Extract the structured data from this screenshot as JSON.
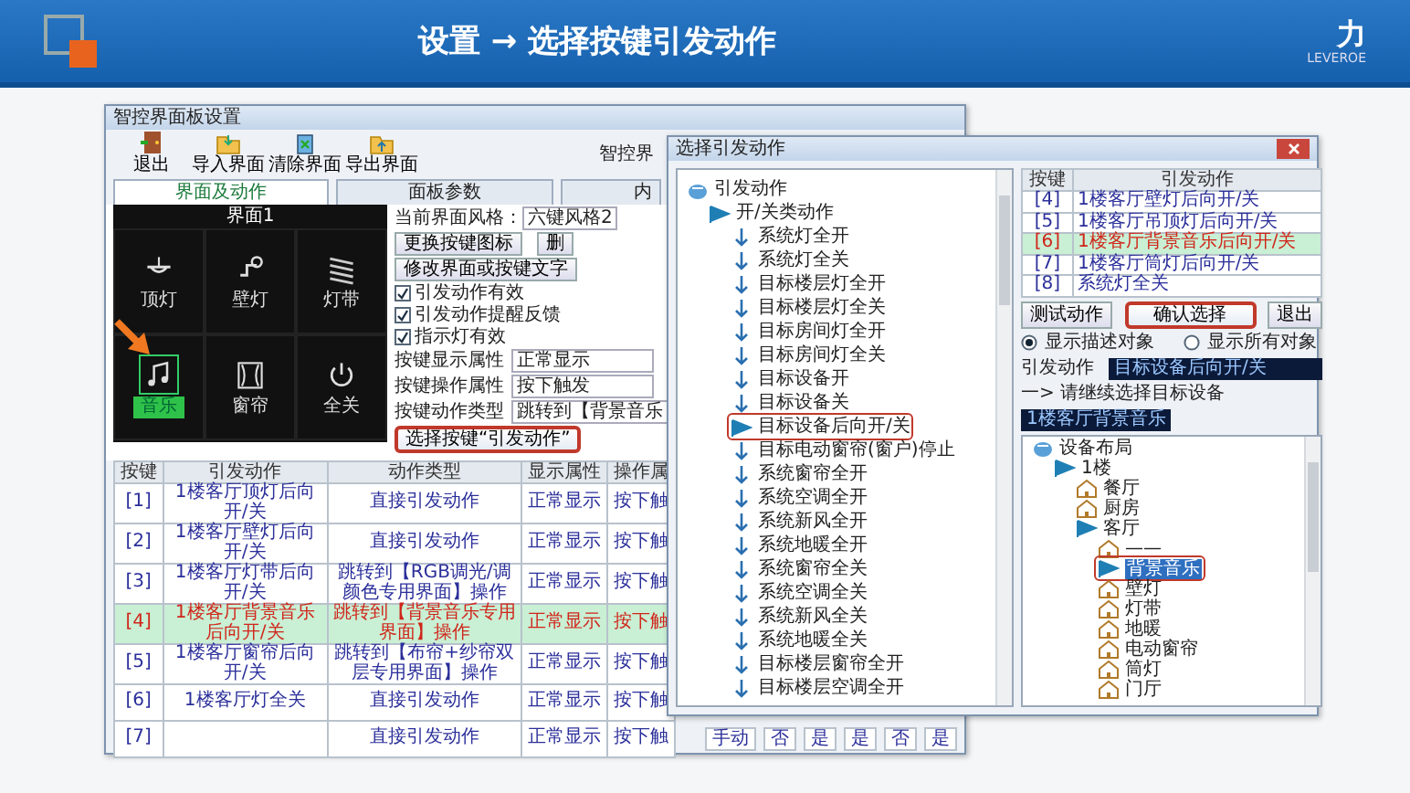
{
  "header": {
    "title": "设置 → 选择按键引发动作",
    "brand": "力",
    "brand_sub": "LEVEROE"
  },
  "main_window": {
    "title": "智控界面板设置",
    "toolbar": [
      {
        "label": "退出",
        "kind": "exit"
      },
      {
        "label": "导入界面",
        "kind": "import"
      },
      {
        "label": "清除界面",
        "kind": "clear"
      },
      {
        "label": "导出界面",
        "kind": "export"
      }
    ],
    "toolbar_caption": "智控界",
    "tabs": [
      {
        "label": "界面及动作",
        "selected": true
      },
      {
        "label": "面板参数",
        "selected": false
      },
      {
        "label": "内",
        "selected": false
      }
    ],
    "panel": {
      "title": "界面1",
      "keys": [
        {
          "label": "顶灯",
          "kind": "ceiling",
          "selected": false
        },
        {
          "label": "壁灯",
          "kind": "wall",
          "selected": false
        },
        {
          "label": "灯带",
          "kind": "strip",
          "selected": false
        },
        {
          "label": "音乐",
          "kind": "music",
          "selected": true
        },
        {
          "label": "窗帘",
          "kind": "curtain",
          "selected": false
        },
        {
          "label": "全关",
          "kind": "power",
          "selected": false
        }
      ]
    },
    "style_label": "当前界面风格：",
    "style_value": "六键风格2",
    "buttons": [
      {
        "label": "更换按键图标"
      },
      {
        "label": "删"
      },
      {
        "label": "修改界面或按键文字"
      }
    ],
    "options": [
      {
        "label": "引发动作有效",
        "checked": true
      },
      {
        "label": "引发动作提醒反馈",
        "checked": true
      },
      {
        "label": "指示灯有效",
        "checked": true
      }
    ],
    "properties": [
      {
        "label": "按键显示属性",
        "value": "正常显示"
      },
      {
        "label": "按键操作属性",
        "value": "按下触发"
      },
      {
        "label": "按键动作类型",
        "value": "跳转到【背景音乐"
      }
    ],
    "select_button": {
      "label": "选择按键“引发动作”",
      "highlighted": true
    },
    "table": {
      "columns": [
        "按键",
        "引发动作",
        "动作类型",
        "显示属性",
        "操作属"
      ],
      "rows": [
        {
          "key": "[1]",
          "action": "1楼客厅顶灯后向开/关",
          "type": "直接引发动作",
          "display": "正常显示",
          "operate": "按下触",
          "selected": false
        },
        {
          "key": "[2]",
          "action": "1楼客厅壁灯后向开/关",
          "type": "直接引发动作",
          "display": "正常显示",
          "operate": "按下触",
          "selected": false
        },
        {
          "key": "[3]",
          "action": "1楼客厅灯带后向开/关",
          "type": "跳转到【RGB调光/调颜色专用界面】操作",
          "display": "正常显示",
          "operate": "按下触",
          "selected": false
        },
        {
          "key": "[4]",
          "action": "1楼客厅背景音乐后向开/关",
          "type": "跳转到【背景音乐专用界面】操作",
          "display": "正常显示",
          "operate": "按下触",
          "selected": true
        },
        {
          "key": "[5]",
          "action": "1楼客厅窗帘后向开/关",
          "type": "跳转到【布帘+纱帘双层专用界面】操作",
          "display": "正常显示",
          "operate": "按下触",
          "selected": false
        },
        {
          "key": "[6]",
          "action": "1楼客厅灯全关",
          "type": "直接引发动作",
          "display": "正常显示",
          "operate": "按下触",
          "selected": false
        },
        {
          "key": "[7]",
          "type": "直接引发动作",
          "display": "正常显示",
          "operate": "按下触",
          "selected": false
        }
      ]
    },
    "row_tail": [
      "手动",
      "否",
      "是",
      "是",
      "否",
      "是"
    ]
  },
  "dialog": {
    "title": "选择引发动作",
    "action_tree": [
      {
        "label": "引发动作",
        "kind": "root",
        "selected": false,
        "children": [
          {
            "label": "开/关类动作",
            "kind": "folder",
            "selected": false,
            "children": [
              {
                "label": "系统灯全开",
                "kind": "action",
                "selected": false
              },
              {
                "label": "系统灯全关",
                "kind": "action",
                "selected": false
              },
              {
                "label": "目标楼层灯全开",
                "kind": "action",
                "selected": false
              },
              {
                "label": "目标楼层灯全关",
                "kind": "action",
                "selected": false
              },
              {
                "label": "目标房间灯全开",
                "kind": "action",
                "selected": false
              },
              {
                "label": "目标房间灯全关",
                "kind": "action",
                "selected": false
              },
              {
                "label": "目标设备开",
                "kind": "action",
                "selected": false
              },
              {
                "label": "目标设备关",
                "kind": "action",
                "selected": false
              },
              {
                "label": "目标设备后向开/关",
                "kind": "action",
                "selected": true
              },
              {
                "label": "目标电动窗帘(窗户)停止",
                "kind": "action",
                "selected": false
              },
              {
                "label": "系统窗帘全开",
                "kind": "action",
                "selected": false
              },
              {
                "label": "系统空调全开",
                "kind": "action",
                "selected": false
              },
              {
                "label": "系统新风全开",
                "kind": "action",
                "selected": false
              },
              {
                "label": "系统地暖全开",
                "kind": "action",
                "selected": false
              },
              {
                "label": "系统窗帘全关",
                "kind": "action",
                "selected": false
              },
              {
                "label": "系统空调全关",
                "kind": "action",
                "selected": false
              },
              {
                "label": "系统新风全关",
                "kind": "action",
                "selected": false
              },
              {
                "label": "系统地暖全关",
                "kind": "action",
                "selected": false
              },
              {
                "label": "目标楼层窗帘全开",
                "kind": "action",
                "selected": false
              },
              {
                "label": "目标楼层空调全开",
                "kind": "action",
                "selected": false
              }
            ]
          }
        ]
      }
    ],
    "key_table": {
      "columns": [
        "按键",
        "引发动作"
      ],
      "rows": [
        {
          "key": "[4]",
          "action": "1楼客厅壁灯后向开/关",
          "selected": false
        },
        {
          "key": "[5]",
          "action": "1楼客厅吊顶灯后向开/关",
          "selected": false
        },
        {
          "key": "[6]",
          "action": "1楼客厅背景音乐后向开/关",
          "selected": true
        },
        {
          "key": "[7]",
          "action": "1楼客厅筒灯后向开/关",
          "selected": false
        },
        {
          "key": "[8]",
          "action": "系统灯全关",
          "selected": false
        }
      ]
    },
    "buttons": [
      {
        "label": "测试动作",
        "highlighted": false
      },
      {
        "label": "确认选择",
        "highlighted": true
      },
      {
        "label": "退出",
        "highlighted": false
      }
    ],
    "display_options": [
      {
        "label": "显示描述对象",
        "selected": true
      },
      {
        "label": "显示所有对象",
        "selected": false
      }
    ],
    "action_label": "引发动作",
    "action_value": "目标设备后向开/关",
    "hint": "一> 请继续选择目标设备",
    "target_value": "1楼客厅背景音乐",
    "device_tree": [
      {
        "label": "设备布局",
        "kind": "root",
        "selected": false,
        "children": [
          {
            "label": "1楼",
            "kind": "folder",
            "selected": false,
            "children": [
              {
                "label": "餐厅",
                "kind": "room",
                "selected": false
              },
              {
                "label": "厨房",
                "kind": "room",
                "selected": false
              },
              {
                "label": "客厅",
                "kind": "folder",
                "selected": false,
                "children": [
                  {
                    "label": "——",
                    "kind": "room",
                    "selected": false
                  },
                  {
                    "label": "背景音乐",
                    "kind": "folder",
                    "selected": true
                  },
                  {
                    "label": "壁灯",
                    "kind": "room",
                    "selected": false
                  },
                  {
                    "label": "灯带",
                    "kind": "room",
                    "selected": false
                  },
                  {
                    "label": "地暖",
                    "kind": "room",
                    "selected": false
                  },
                  {
                    "label": "电动窗帘",
                    "kind": "room",
                    "selected": false
                  },
                  {
                    "label": "筒灯",
                    "kind": "room",
                    "selected": false
                  },
                  {
                    "label": "门厅",
                    "kind": "room",
                    "selected": false
                  }
                ]
              }
            ]
          }
        ]
      }
    ]
  }
}
